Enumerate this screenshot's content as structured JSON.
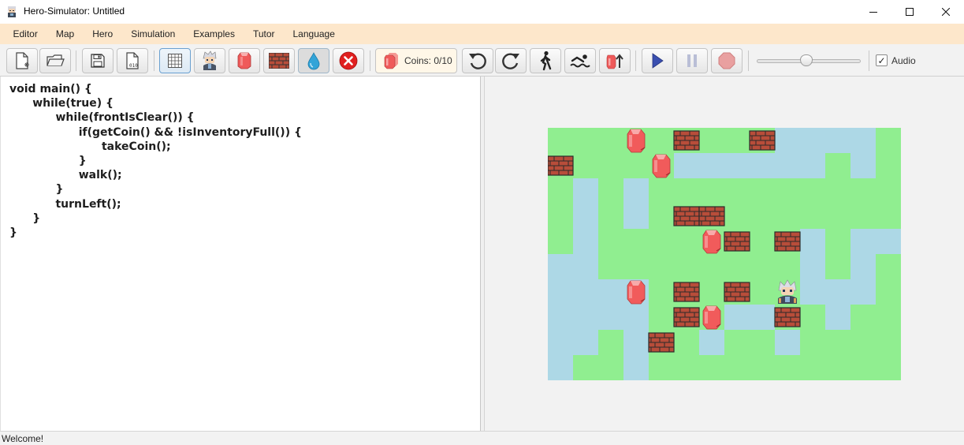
{
  "window": {
    "title": "Hero-Simulator: Untitled"
  },
  "menu": [
    "Editor",
    "Map",
    "Hero",
    "Simulation",
    "Examples",
    "Tutor",
    "Language"
  ],
  "toolbar": {
    "buttons": [
      "new-file",
      "open-file",
      "save-file",
      "compile-file",
      "grid",
      "hero",
      "coin",
      "wall",
      "water",
      "delete",
      "rotate-left",
      "rotate-right",
      "walk",
      "swim",
      "pick-up",
      "play",
      "pause",
      "stop"
    ],
    "coins_label": "Coins: 0/10",
    "speed_level": 0.48,
    "audio_label": "Audio",
    "audio_checked": true
  },
  "editor": {
    "code": [
      "void main() {",
      "      while(true) {",
      "            while(frontIsClear()) {",
      "                  if(getCoin() && !isInventoryFull()) {",
      "                        takeCoin();",
      "                  }",
      "                  walk();",
      "            }",
      "            turnLeft();",
      "      }",
      "}"
    ]
  },
  "world": {
    "cols": 14,
    "rows": 10,
    "colors": {
      "grass": "#90ee90",
      "water": "#add8e6",
      "wall": "#b84d3a",
      "coin": "#f15b5b"
    },
    "terrain": [
      "GGGGGGGGGWWWWG",
      "GGGGGWWWWWWGWG",
      "GWGWGGGGGGGGGG",
      "GWGWGGGGGGGGGG",
      "GWGGGGGGGGWGWW",
      "WWGGGGGGGGWGWG",
      "WWWWGGGGGGWWWG",
      "WWWWGGGWWGGWGG",
      "WWGWGGWGGWGGGG",
      "WGGWGGGGGGGGGG"
    ],
    "objects": [
      {
        "type": "coin",
        "col": 3,
        "row": 0
      },
      {
        "type": "wall",
        "col": 5,
        "row": 0
      },
      {
        "type": "wall",
        "col": 8,
        "row": 0
      },
      {
        "type": "wall",
        "col": 0,
        "row": 1
      },
      {
        "type": "coin",
        "col": 4,
        "row": 1
      },
      {
        "type": "wall",
        "col": 5,
        "row": 3
      },
      {
        "type": "wall",
        "col": 6,
        "row": 3
      },
      {
        "type": "coin",
        "col": 6,
        "row": 4
      },
      {
        "type": "wall",
        "col": 7,
        "row": 4
      },
      {
        "type": "wall",
        "col": 9,
        "row": 4
      },
      {
        "type": "coin",
        "col": 3,
        "row": 6
      },
      {
        "type": "wall",
        "col": 5,
        "row": 6
      },
      {
        "type": "wall",
        "col": 7,
        "row": 6
      },
      {
        "type": "hero",
        "col": 9,
        "row": 6
      },
      {
        "type": "wall",
        "col": 5,
        "row": 7
      },
      {
        "type": "coin",
        "col": 6,
        "row": 7
      },
      {
        "type": "wall",
        "col": 9,
        "row": 7
      },
      {
        "type": "wall",
        "col": 4,
        "row": 8
      }
    ]
  },
  "status": {
    "text": "Welcome!"
  }
}
